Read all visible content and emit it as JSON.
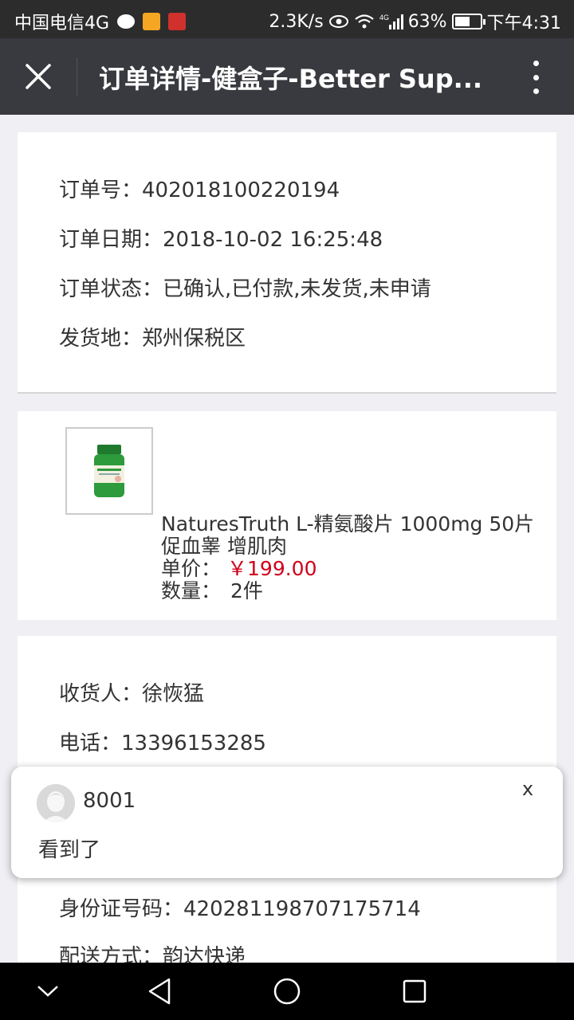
{
  "status_bar": {
    "carrier": "中国电信4G",
    "speed": "2.3K/s",
    "network": "4G",
    "battery": "63%",
    "battery_level": 0.63,
    "time": "下午4:31"
  },
  "nav": {
    "title": "订单详情-健盒子-Better Sup..."
  },
  "order": {
    "id_label": "订单号：",
    "id": "402018100220194",
    "date_label": "订单日期：",
    "date": "2018-10-02 16:25:48",
    "status_label": "订单状态：",
    "status": "已确认,已付款,未发货,未申请",
    "origin_label": "发货地：",
    "origin": "郑州保税区"
  },
  "product": {
    "name": "NaturesTruth L-精氨酸片 1000mg 50片 促血睾 增肌肉",
    "price_label": "单价：",
    "price": "￥199.00",
    "qty_label": "数量：",
    "qty": "2件"
  },
  "receiver": {
    "name_label": "收货人：",
    "name": "徐恢猛",
    "phone_label": "电话：",
    "phone": "13396153285",
    "idcard_label": "身份证号码：",
    "idcard": "420281198707175714",
    "delivery_label": "配送方式：",
    "delivery": "韵达快递"
  },
  "notification": {
    "sender": "8001",
    "message": "看到了",
    "close_label": "x"
  },
  "colors": {
    "price": "#d0021b",
    "navbar": "#393a3f",
    "statusbar": "#2c2c2c"
  }
}
